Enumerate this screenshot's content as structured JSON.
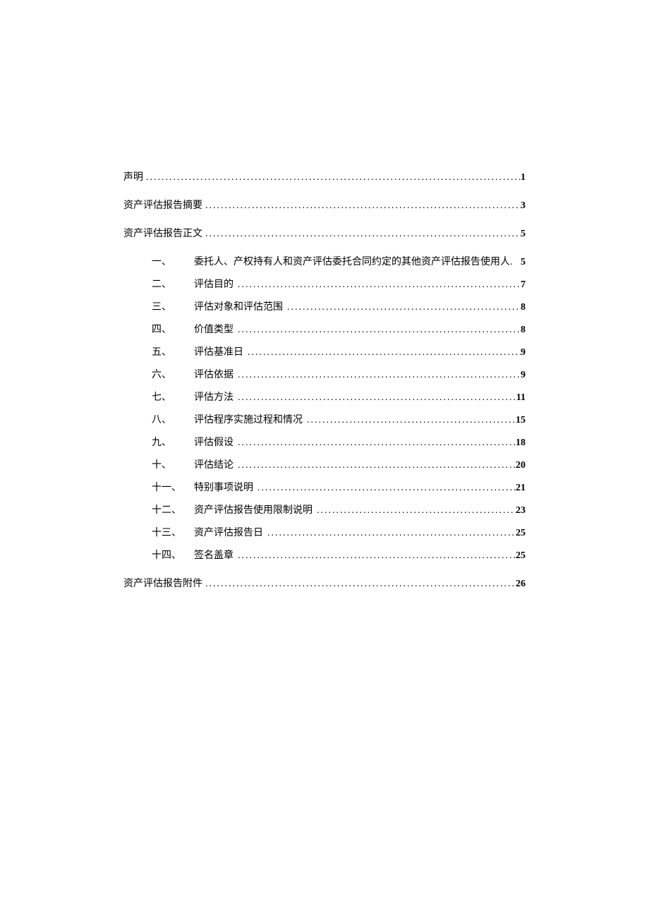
{
  "toc": {
    "top": [
      {
        "title": "声明",
        "page": "1"
      },
      {
        "title": "资产评估报告摘要",
        "page": "3"
      },
      {
        "title": "资产评估报告正文",
        "page": "5"
      }
    ],
    "sub": [
      {
        "num": "一、",
        "title": "委托人、产权持有人和资产评估委托合同约定的其他资产评估报告使用人.",
        "page": "5",
        "no_leader": true
      },
      {
        "num": "二、",
        "title": "评估目的",
        "page": "7"
      },
      {
        "num": "三、",
        "title": "评估对象和评估范围",
        "page": "8"
      },
      {
        "num": "四、",
        "title": "价值类型",
        "page": "8"
      },
      {
        "num": "五、",
        "title": "评估基准日",
        "page": "9"
      },
      {
        "num": "六、",
        "title": "评估依据",
        "page": "9"
      },
      {
        "num": "七、",
        "title": "评估方法",
        "page": "11"
      },
      {
        "num": "八、",
        "title": "评估程序实施过程和情况",
        "page": "15"
      },
      {
        "num": "九、",
        "title": "评估假设",
        "page": "18"
      },
      {
        "num": "十、",
        "title": "评估结论",
        "page": "20"
      },
      {
        "num": "十一、",
        "title": "特别事项说明",
        "page": "21"
      },
      {
        "num": "十二、",
        "title": "资产评估报告使用限制说明",
        "page": "23"
      },
      {
        "num": "十三、",
        "title": "资产评估报告日",
        "page": "25"
      },
      {
        "num": "十四、",
        "title": "签名盖章",
        "page": "25"
      }
    ],
    "bottom": [
      {
        "title": "资产评估报告附件",
        "page": "26"
      }
    ]
  }
}
